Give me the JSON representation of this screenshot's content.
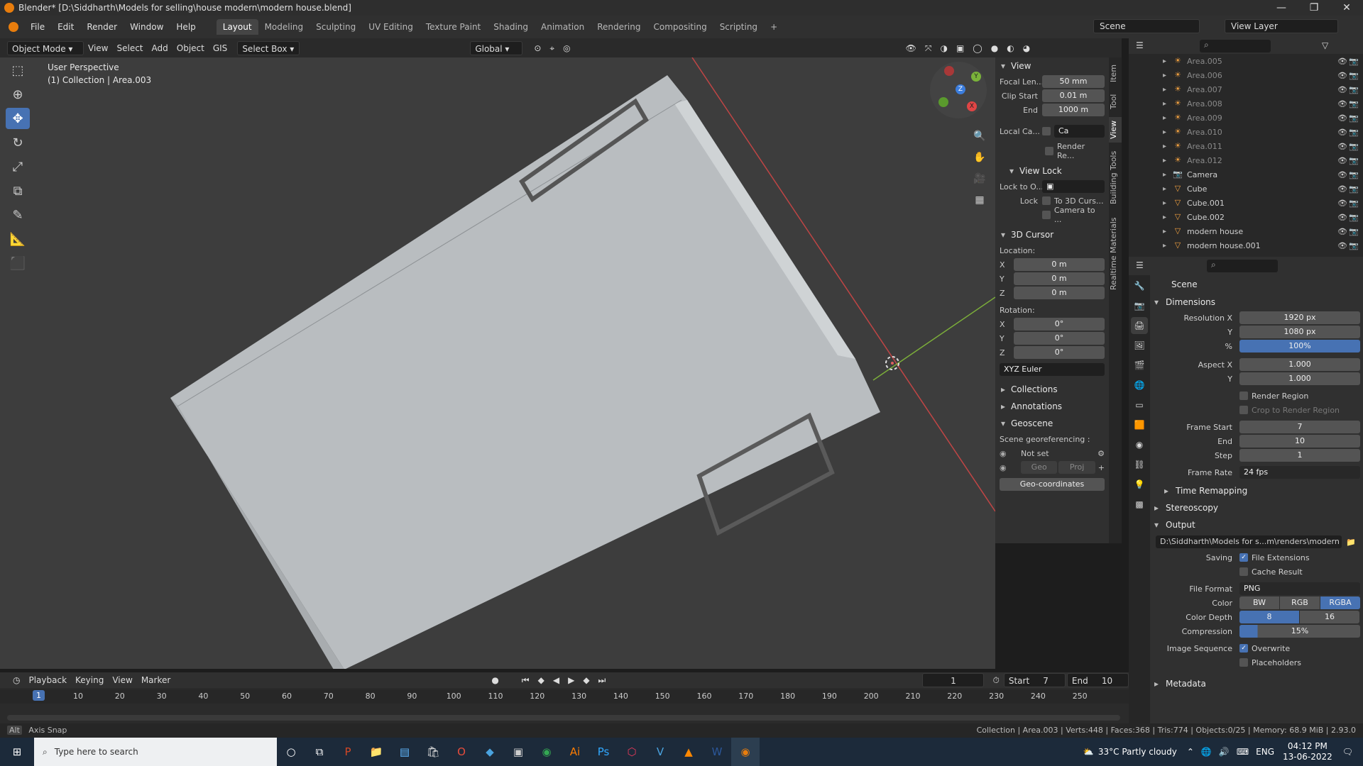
{
  "window": {
    "title": "Blender* [D:\\Siddharth\\Models for selling\\house modern\\modern house.blend]"
  },
  "menu": [
    "File",
    "Edit",
    "Render",
    "Window",
    "Help"
  ],
  "workspaces": [
    "Layout",
    "Modeling",
    "Sculpting",
    "UV Editing",
    "Texture Paint",
    "Shading",
    "Animation",
    "Rendering",
    "Compositing",
    "Scripting"
  ],
  "active_workspace": "Layout",
  "scene_name": "Scene",
  "view_layer": "View Layer",
  "header": {
    "mode": "Object Mode",
    "view": "View",
    "select": "Select",
    "add": "Add",
    "object": "Object",
    "gis": "GIS",
    "select_box": "Select Box",
    "transform": "Global"
  },
  "viewport": {
    "perspective": "User Perspective",
    "collection_info": "(1) Collection | Area.003"
  },
  "gizmo": {
    "x": "X",
    "y": "Y",
    "z": "Z"
  },
  "npanel": {
    "view_title": "View",
    "focal_label": "Focal Len...",
    "focal_value": "50 mm",
    "clip_start_label": "Clip Start",
    "clip_start_value": "0.01 m",
    "clip_end_label": "End",
    "clip_end_value": "1000 m",
    "local_cam_label": "Local Ca...",
    "local_cam_value": "Ca",
    "render_region_label": "Render Re...",
    "view_lock_title": "View Lock",
    "lock_obj_label": "Lock to O...",
    "lock_label": "Lock",
    "to_3d_cursor": "To 3D Curs...",
    "camera_to": "Camera to ...",
    "cursor_title": "3D Cursor",
    "location_label": "Location:",
    "loc_x": "0 m",
    "loc_y": "0 m",
    "loc_z": "0 m",
    "rotation_label": "Rotation:",
    "rot_x": "0°",
    "rot_y": "0°",
    "rot_z": "0°",
    "rot_mode": "XYZ Euler",
    "collections": "Collections",
    "annotations": "Annotations",
    "geoscene": "Geoscene",
    "georef_label": "Scene georeferencing :",
    "not_set": "Not set",
    "geo_btn": "Geo",
    "proj_btn": "Proj",
    "geo_coords": "Geo-coordinates"
  },
  "vtabs": [
    "Item",
    "Tool",
    "View",
    "Building Tools",
    "Realtime Materials"
  ],
  "outliner": [
    {
      "name": "Area.005",
      "dim": true,
      "type": "light"
    },
    {
      "name": "Area.006",
      "dim": true,
      "type": "light"
    },
    {
      "name": "Area.007",
      "dim": true,
      "type": "light"
    },
    {
      "name": "Area.008",
      "dim": true,
      "type": "light"
    },
    {
      "name": "Area.009",
      "dim": true,
      "type": "light"
    },
    {
      "name": "Area.010",
      "dim": true,
      "type": "light"
    },
    {
      "name": "Area.011",
      "dim": true,
      "type": "light"
    },
    {
      "name": "Area.012",
      "dim": true,
      "type": "light"
    },
    {
      "name": "Camera",
      "dim": false,
      "type": "camera"
    },
    {
      "name": "Cube",
      "dim": false,
      "type": "mesh"
    },
    {
      "name": "Cube.001",
      "dim": false,
      "type": "mesh"
    },
    {
      "name": "Cube.002",
      "dim": false,
      "type": "mesh"
    },
    {
      "name": "modern house",
      "dim": false,
      "type": "mesh"
    },
    {
      "name": "modern house.001",
      "dim": false,
      "type": "mesh"
    }
  ],
  "properties": {
    "context": "Scene",
    "dimensions": "Dimensions",
    "res_x_label": "Resolution X",
    "res_x": "1920 px",
    "res_y_label": "Y",
    "res_y": "1080 px",
    "res_pct_label": "%",
    "res_pct": "100%",
    "aspect_x_label": "Aspect X",
    "aspect_x": "1.000",
    "aspect_y_label": "Y",
    "aspect_y": "1.000",
    "render_region": "Render Region",
    "crop": "Crop to Render Region",
    "frame_start_label": "Frame Start",
    "frame_start": "7",
    "frame_end_label": "End",
    "frame_end": "10",
    "step_label": "Step",
    "step": "1",
    "frame_rate_label": "Frame Rate",
    "frame_rate": "24 fps",
    "time_remap": "Time Remapping",
    "stereo": "Stereoscopy",
    "output": "Output",
    "output_path": "D:\\Siddharth\\Models for s...m\\renders\\modern house",
    "saving_label": "Saving",
    "file_ext": "File Extensions",
    "cache": "Cache Result",
    "format_label": "File Format",
    "format": "PNG",
    "color_label": "Color",
    "color_bw": "BW",
    "color_rgb": "RGB",
    "color_rgba": "RGBA",
    "depth_label": "Color Depth",
    "depth_8": "8",
    "depth_16": "16",
    "compression_label": "Compression",
    "compression": "15%",
    "imgseq_label": "Image Sequence",
    "overwrite": "Overwrite",
    "placeholders": "Placeholders",
    "metadata": "Metadata"
  },
  "timeline": {
    "playback": "Playback",
    "keying": "Keying",
    "view": "View",
    "marker": "Marker",
    "current_frame": "1",
    "start_label": "Start",
    "start": "7",
    "end_label": "End",
    "end": "10",
    "ruler_current": "1",
    "ruler": [
      "10",
      "20",
      "30",
      "40",
      "50",
      "60",
      "70",
      "80",
      "90",
      "100",
      "110",
      "120",
      "130",
      "140",
      "150",
      "160",
      "170",
      "180",
      "190",
      "200",
      "210",
      "220",
      "230",
      "240",
      "250"
    ]
  },
  "status": {
    "left": "Axis Snap",
    "right": "Collection | Area.003 | Verts:448 | Faces:368 | Tris:774 | Objects:0/25 | Memory: 68.9 MiB | 2.93.0"
  },
  "taskbar": {
    "search_placeholder": "Type here to search",
    "weather": "33°C  Partly cloudy",
    "lang": "ENG",
    "time": "04:12 PM",
    "date": "13-06-2022"
  },
  "colors": {
    "accent": "#4772b3",
    "x_axis": "#e06060",
    "y_axis": "#8cc63f",
    "object": "#c7cbcd"
  }
}
